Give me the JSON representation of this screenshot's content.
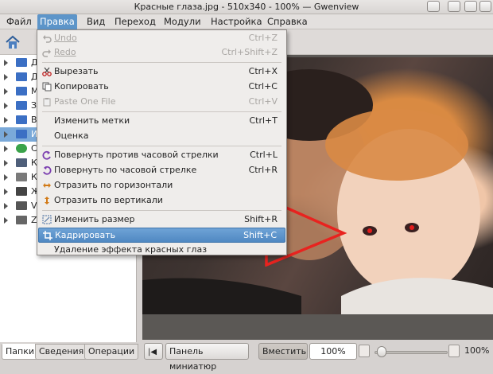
{
  "window": {
    "title": "Красные глаза.jpg - 510x340 - 100% — Gwenview"
  },
  "menubar": [
    {
      "label": "Файл"
    },
    {
      "label": "Правка"
    },
    {
      "label": "Вид"
    },
    {
      "label": "Переход"
    },
    {
      "label": "Модули"
    },
    {
      "label": "Настройка"
    },
    {
      "label": "Справка"
    }
  ],
  "sidebar": {
    "rows": [
      {
        "label": "Д",
        "icon_color": "#3b6fc4"
      },
      {
        "label": "Д",
        "icon_color": "#3b6fc4"
      },
      {
        "label": "М",
        "icon_color": "#3b6fc4"
      },
      {
        "label": "З",
        "icon_color": "#3b6fc4"
      },
      {
        "label": "В",
        "icon_color": "#3b6fc4"
      },
      {
        "label": "И",
        "icon_color": "#3b6fc4"
      },
      {
        "label": "С",
        "icon_color": "#3aa34a"
      },
      {
        "label": "К",
        "icon_color": "#4f5f7a"
      },
      {
        "label": "К",
        "icon_color": "#7a7a7a"
      },
      {
        "label": "Ж",
        "icon_color": "#444444"
      },
      {
        "label": "V",
        "icon_color": "#555555"
      },
      {
        "label": "Z",
        "icon_color": "#666666"
      }
    ],
    "tabs": [
      "Папки",
      "Сведения",
      "Операции"
    ]
  },
  "edit_menu": {
    "items": [
      {
        "label": "Undo",
        "shortcut": "Ctrl+Z",
        "disabled": true,
        "icon": "undo-icon"
      },
      {
        "label": "Redo",
        "shortcut": "Ctrl+Shift+Z",
        "disabled": true,
        "icon": "redo-icon"
      },
      {
        "label": "Вырезать",
        "shortcut": "Ctrl+X",
        "disabled": false,
        "icon": "scissors-icon"
      },
      {
        "label": "Копировать",
        "shortcut": "Ctrl+C",
        "disabled": false,
        "icon": "copy-icon"
      },
      {
        "label": "Paste One File",
        "shortcut": "Ctrl+V",
        "disabled": true,
        "icon": "paste-icon"
      },
      {
        "label": "Изменить метки",
        "shortcut": "Ctrl+T",
        "disabled": false,
        "icon": ""
      },
      {
        "label": "Оценка",
        "shortcut": "",
        "disabled": false,
        "icon": ""
      },
      {
        "label": "Повернуть против часовой стрелки",
        "shortcut": "Ctrl+L",
        "disabled": false,
        "icon": "rotate-left-icon"
      },
      {
        "label": "Повернуть по часовой стрелке",
        "shortcut": "Ctrl+R",
        "disabled": false,
        "icon": "rotate-right-icon"
      },
      {
        "label": "Отразить по горизонтали",
        "shortcut": "",
        "disabled": false,
        "icon": "flip-horizontal-icon"
      },
      {
        "label": "Отразить по вертикали",
        "shortcut": "",
        "disabled": false,
        "icon": "flip-vertical-icon"
      },
      {
        "label": "Изменить размер",
        "shortcut": "Shift+R",
        "disabled": false,
        "icon": "resize-icon"
      },
      {
        "label": "Кадрировать",
        "shortcut": "Shift+C",
        "disabled": false,
        "icon": "crop-icon",
        "highlighted": true
      },
      {
        "label": "Удаление эффекта красных глаз",
        "shortcut": "",
        "disabled": false,
        "icon": ""
      }
    ]
  },
  "statusbar": {
    "thumbnail_button": "Панель миниатюр",
    "fit_button": "Вместить",
    "zoom_value": "100%",
    "zoom_label": "100%",
    "zoom_level": 0.04
  },
  "colors": {
    "accent": "#5d95c9",
    "highlight": "#4f88c2",
    "annotation_arrow": "#e8231f"
  }
}
